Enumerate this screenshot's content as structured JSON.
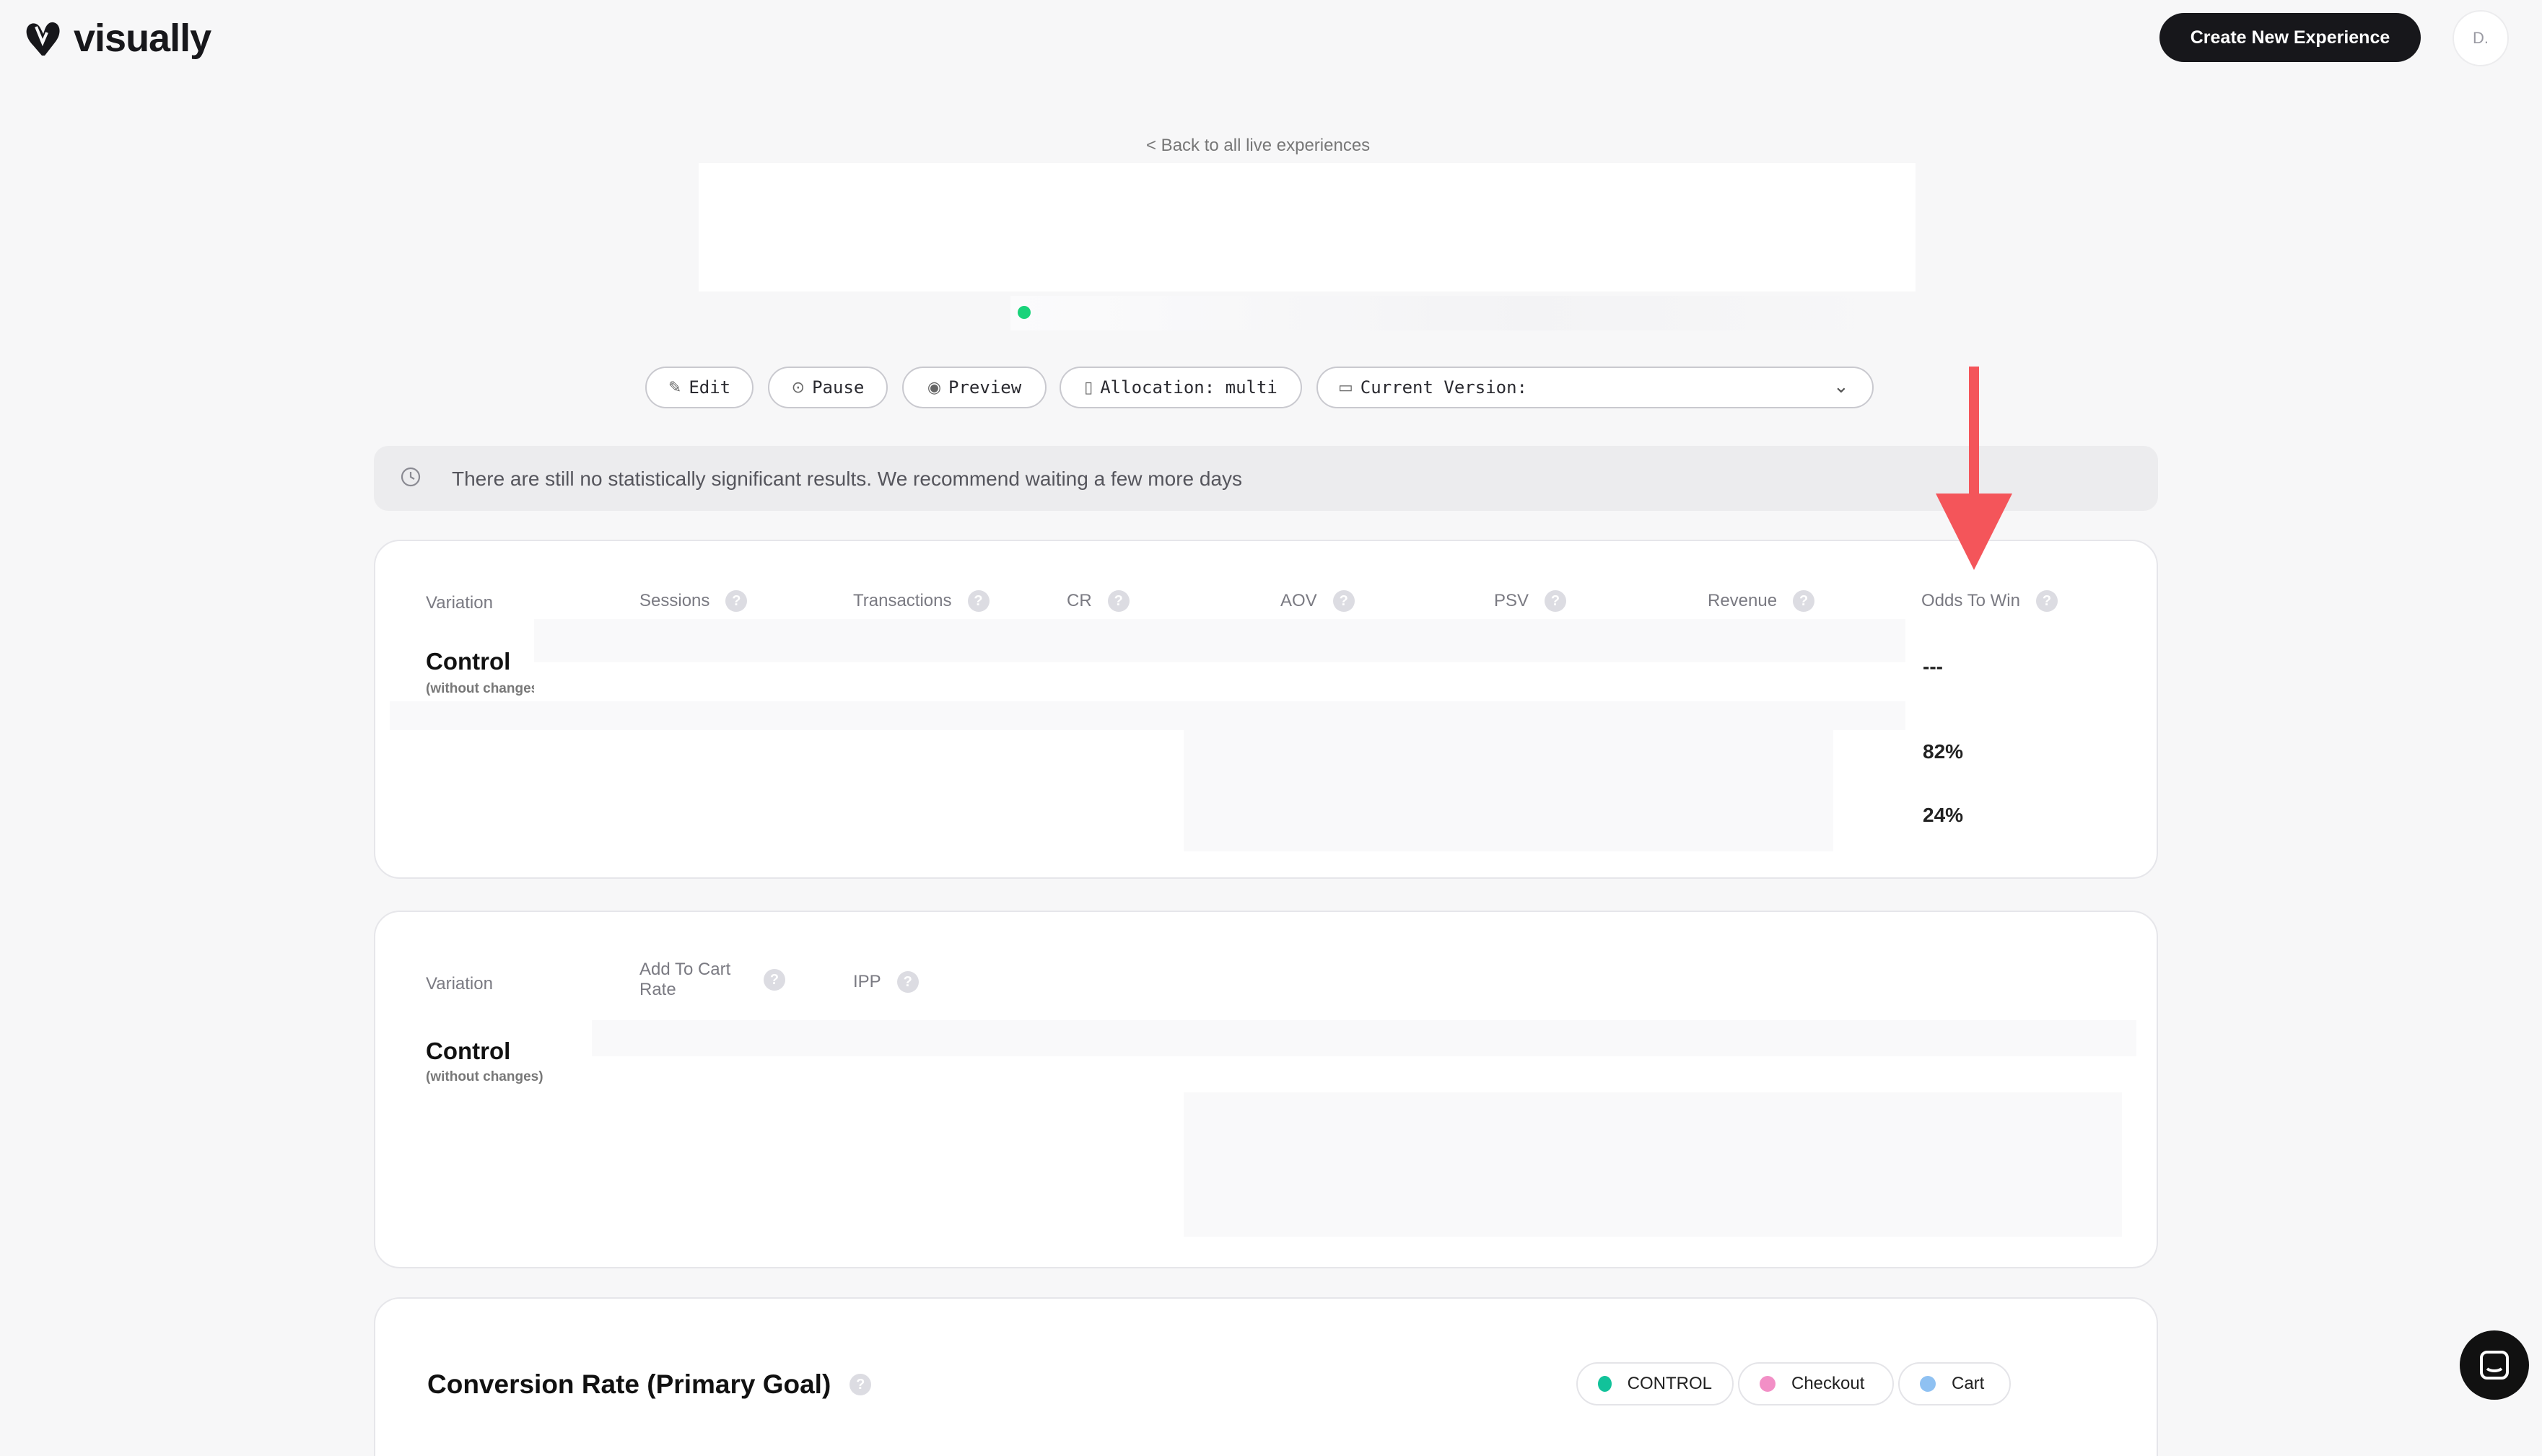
{
  "header": {
    "logo_text": "visually",
    "create_button": "Create New Experience",
    "avatar_initial": "D."
  },
  "nav": {
    "back_link": "< Back to all live experiences"
  },
  "toolbar": {
    "edit": "Edit",
    "pause": "Pause",
    "preview": "Preview",
    "allocation": "Allocation: multi",
    "current_version": "Current Version:"
  },
  "notice": {
    "text": "There are still no statistically significant results. We recommend waiting a few more days"
  },
  "metrics_table": {
    "columns": [
      "Variation",
      "Sessions",
      "Transactions",
      "CR",
      "AOV",
      "PSV",
      "Revenue",
      "Odds To Win"
    ],
    "control_name": "Control",
    "control_sub": "(without changes)",
    "odds_to_win": [
      "---",
      "82%",
      "24%"
    ]
  },
  "secondary_table": {
    "columns": [
      "Variation",
      "Add To Cart Rate",
      "IPP"
    ],
    "control_name": "Control",
    "control_sub": "(without changes)"
  },
  "conversion_chart": {
    "title": "Conversion Rate (Primary Goal)",
    "legend": [
      {
        "label": "CONTROL",
        "color": "#12c29a"
      },
      {
        "label": "Checkout",
        "color": "#f28fc6"
      },
      {
        "label": "Cart",
        "color": "#8fc1f2"
      }
    ]
  },
  "colors": {
    "accent_dark": "#17171b",
    "status_live": "#19d37a",
    "annotation_arrow": "#f4555a"
  }
}
